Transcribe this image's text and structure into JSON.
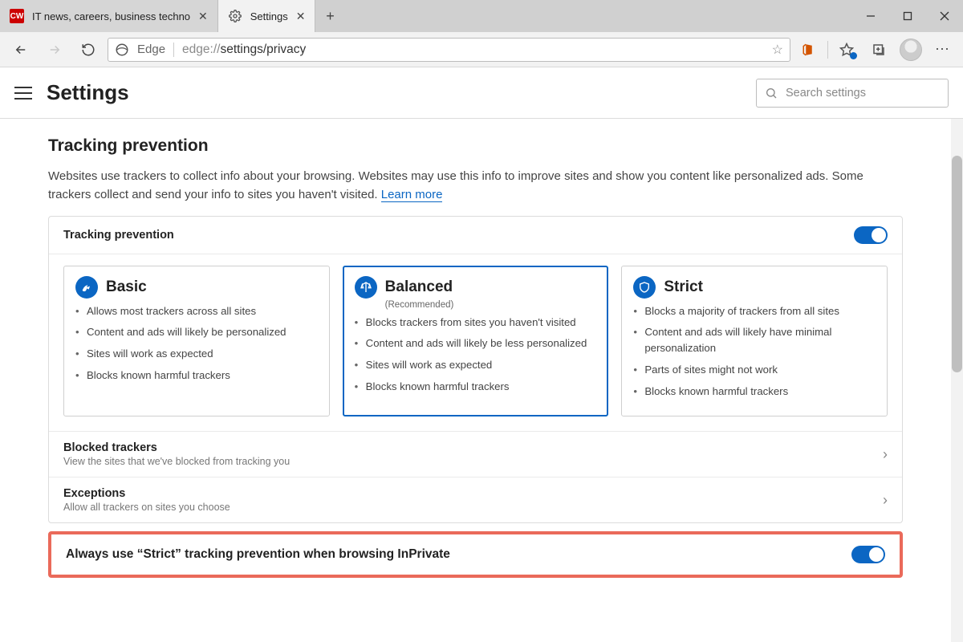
{
  "tabs": [
    {
      "label": "IT news, careers, business techno",
      "favicon": "CW"
    },
    {
      "label": "Settings",
      "favicon": "gear"
    }
  ],
  "addressbar": {
    "app_label": "Edge",
    "url_proto": "edge://",
    "url_path": "settings/privacy"
  },
  "header": {
    "title": "Settings",
    "search_placeholder": "Search settings"
  },
  "tracking": {
    "title": "Tracking prevention",
    "desc": "Websites use trackers to collect info about your browsing. Websites may use this info to improve sites and show you content like personalized ads. Some trackers collect and send your info to sites you haven't visited. ",
    "learn_more": "Learn more",
    "card_label": "Tracking prevention",
    "toggle_on": true,
    "options": [
      {
        "icon": "basic-icon",
        "title": "Basic",
        "subtitle": "",
        "bullets": [
          "Allows most trackers across all sites",
          "Content and ads will likely be personalized",
          "Sites will work as expected",
          "Blocks known harmful trackers"
        ]
      },
      {
        "icon": "balanced-icon",
        "title": "Balanced",
        "subtitle": "(Recommended)",
        "bullets": [
          "Blocks trackers from sites you haven't visited",
          "Content and ads will likely be less personalized",
          "Sites will work as expected",
          "Blocks known harmful trackers"
        ]
      },
      {
        "icon": "strict-icon",
        "title": "Strict",
        "subtitle": "",
        "bullets": [
          "Blocks a majority of trackers from all sites",
          "Content and ads will likely have minimal personalization",
          "Parts of sites might not work",
          "Blocks known harmful trackers"
        ]
      }
    ],
    "rows": {
      "blocked_title": "Blocked trackers",
      "blocked_desc": "View the sites that we've blocked from tracking you",
      "exceptions_title": "Exceptions",
      "exceptions_desc": "Allow all trackers on sites you choose",
      "inprivate": "Always use “Strict” tracking prevention when browsing InPrivate"
    }
  }
}
